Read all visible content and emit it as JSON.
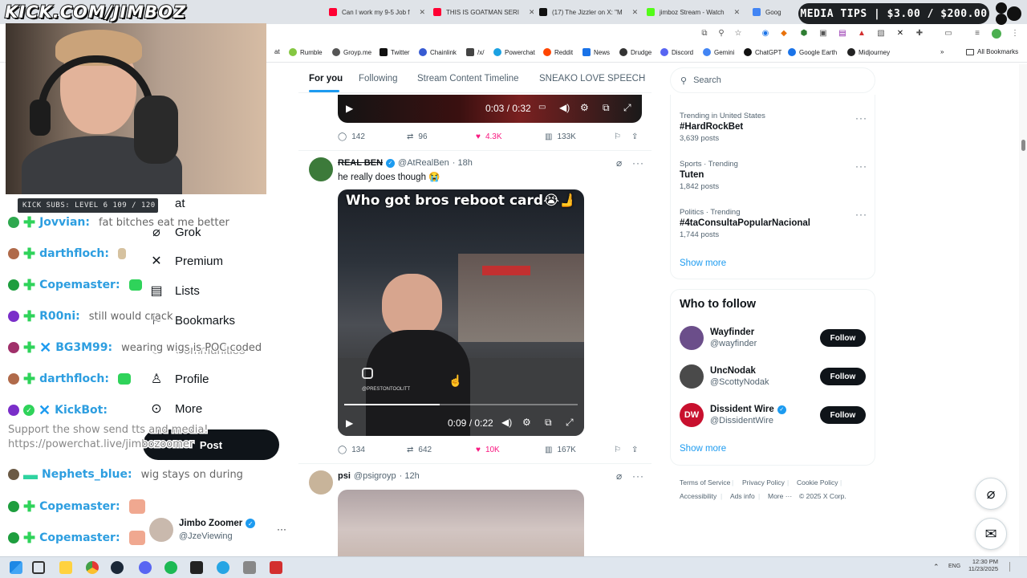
{
  "overlay": {
    "kick_url": "KICK.COM/JIMBOZ",
    "subs_goal": "KICK SUBS: LEVEL 6 109 / 120",
    "media_tips": "MEDIA TIPS | $3.00 / $200.00",
    "support_line1": "Support the show send tts and media!",
    "support_line2": "https://powerchat.live/jimbozoomer"
  },
  "browser": {
    "tabs": [
      {
        "title": "Can I work my 9-5 Job f",
        "color": "#ff0033"
      },
      {
        "title": "THIS IS GOATMAN SERI",
        "color": "#ff0033"
      },
      {
        "title": "(17) The Jizzler on X: \"M",
        "color": "#111111"
      },
      {
        "title": "jimboz Stream - Watch",
        "color": "#53fc18"
      },
      {
        "title": "Goog",
        "color": "#4285f4"
      }
    ],
    "bookmarks": [
      {
        "label": "at",
        "color": "#888"
      },
      {
        "label": "Rumble",
        "color": "#85c742"
      },
      {
        "label": "Groyp.me",
        "color": "#555"
      },
      {
        "label": "Twitter",
        "color": "#111"
      },
      {
        "label": "Chainlink",
        "color": "#375bd2"
      },
      {
        "label": "/x/",
        "color": "#444"
      },
      {
        "label": "Powerchat",
        "color": "#1ba1e2"
      },
      {
        "label": "Reddit",
        "color": "#ff4500"
      },
      {
        "label": "News",
        "color": "#1a73e8"
      },
      {
        "label": "Drudge",
        "color": "#333"
      },
      {
        "label": "Discord",
        "color": "#5865f2"
      },
      {
        "label": "Gemini",
        "color": "#4285f4"
      },
      {
        "label": "ChatGPT",
        "color": "#111"
      },
      {
        "label": "Google Earth",
        "color": "#1a73e8"
      },
      {
        "label": "Midjourney",
        "color": "#222"
      }
    ],
    "all_bookmarks": "All Bookmarks"
  },
  "nav": {
    "partial_top": "at",
    "items": [
      {
        "label": "Grok",
        "icon": "grok-icon",
        "glyph": "⌀"
      },
      {
        "label": "Premium",
        "icon": "x-logo-icon",
        "glyph": "𝕏"
      },
      {
        "label": "Lists",
        "icon": "list-icon",
        "glyph": "▤"
      },
      {
        "label": "Bookmarks",
        "icon": "bookmark-icon",
        "glyph": "⚐"
      },
      {
        "label": "Communities",
        "icon": "communities-icon",
        "glyph": "⚇"
      },
      {
        "label": "Profile",
        "icon": "person-icon",
        "glyph": "♙"
      },
      {
        "label": "More",
        "icon": "more-circle-icon",
        "glyph": "⊙"
      }
    ],
    "post_button": "Post",
    "account": {
      "name": "Jimbo Zoomer",
      "handle": "@JzeViewing"
    }
  },
  "chat": [
    {
      "user": "Jovvian:",
      "msg": "fat bitches eat me better",
      "badge": "#2fa84f",
      "emote": ""
    },
    {
      "user": "darthfloch:",
      "msg": "",
      "badge": "#b06a4a",
      "emote": "#d6c2a0"
    },
    {
      "user": "Copemaster:",
      "msg": "",
      "badge": "#1e9e3e",
      "emote": "#2fd35a"
    },
    {
      "user": "R00ni:",
      "msg": "still would crack",
      "badge": "#7a2ec9",
      "emote": ""
    },
    {
      "user": "BG3M99:",
      "msg": "wearing wigs is POC coded",
      "badge": "#a0306a",
      "emote": ""
    },
    {
      "user": "darthfloch:",
      "msg": "",
      "badge": "#b06a4a",
      "emote": "#2fd35a"
    },
    {
      "user": "KickBot:",
      "msg": "",
      "badge": "#7a2ec9",
      "emote": ""
    },
    {
      "user": "Nephets_blue:",
      "msg": "wig stays on during",
      "badge": "#6b5a45",
      "emote": ""
    },
    {
      "user": "Copemaster:",
      "msg": "",
      "badge": "#1e9e3e",
      "emote": "#f0a890"
    },
    {
      "user": "Copemaster:",
      "msg": "",
      "badge": "#1e9e3e",
      "emote": "#f0a890"
    }
  ],
  "feed": {
    "tabs": [
      "For you",
      "Following",
      "Stream Content Timeline",
      "SNEAKO LOVE SPEECH"
    ],
    "top_video": {
      "time": "0:03 / 0:32"
    },
    "top_actions": {
      "replies": "142",
      "reposts": "96",
      "likes": "4.3K",
      "views": "133K"
    },
    "tweet1": {
      "name": "REAL BEN",
      "handle": "@AtRealBen",
      "time": "· 18h",
      "text": "he really does though 😭",
      "video_caption": "Who got bros reboot card😭🫸",
      "watermark": "@PRESTONTOOLITT",
      "video_time": "0:09 / 0:22",
      "progress": 0.41,
      "actions": {
        "replies": "134",
        "reposts": "642",
        "likes": "10K",
        "views": "167K"
      }
    },
    "tweet2": {
      "name": "psi",
      "handle": "@psigroyp",
      "time": "· 12h"
    }
  },
  "sidebar": {
    "search_placeholder": "Search",
    "trends": [
      {
        "context": "Trending in United States",
        "name": "#HardRockBet",
        "count": "3,639 posts"
      },
      {
        "context": "Sports · Trending",
        "name": "Tuten",
        "count": "1,842 posts"
      },
      {
        "context": "Politics · Trending",
        "name": "#4taConsultaPopularNacional",
        "count": "1,744 posts"
      }
    ],
    "show_more": "Show more",
    "who_to_follow_title": "Who to follow",
    "follow_suggestions": [
      {
        "name": "Wayfinder",
        "handle": "@wayfinder",
        "color": "#6b4e8a",
        "verified": false
      },
      {
        "name": "UncNodak",
        "handle": "@ScottyNodak",
        "color": "#4a4a4a",
        "verified": false
      },
      {
        "name": "Dissident Wire",
        "handle": "@DissidentWire",
        "color": "#c8102e",
        "verified": true
      }
    ],
    "follow_label": "Follow",
    "footer_line1": [
      "Terms of Service",
      "Privacy Policy",
      "Cookie Policy"
    ],
    "footer_line2": [
      "Accessibility",
      "Ads info",
      "More ···",
      "© 2025 X Corp."
    ]
  },
  "taskbar": {
    "lang": "ENG",
    "time": "12:30 PM",
    "date": "11/23/2025",
    "apps": [
      "#ffd23f",
      "#1e88e5",
      "#e53935",
      "#1b2838",
      "#5865f2",
      "#1db954",
      "#222",
      "#26a5e4",
      "#888",
      "#d32f2f"
    ]
  }
}
